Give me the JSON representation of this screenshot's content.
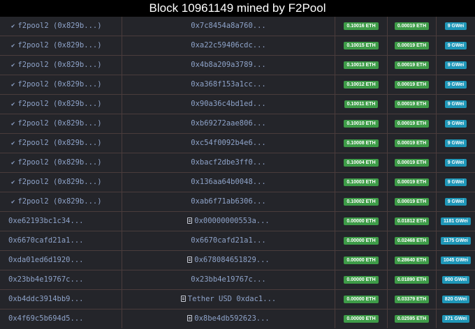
{
  "title": "Block 10961149 mined by F2Pool",
  "colors": {
    "value_badge": "#3e9c48",
    "fee_badge": "#3e9c48",
    "gas_badge": "#1f97b8",
    "address": "#8ea3c9",
    "background": "#24252a"
  },
  "icons": {
    "miner_check": "checkmark-icon",
    "contract": "document-icon"
  },
  "check_glyph": "✔",
  "rows": [
    {
      "miner": true,
      "from": "f2pool2 (0x829b...)",
      "contract": false,
      "to": "0x7c8454a8a760...",
      "value": "0.10016 ETH",
      "fee": "0.00019 ETH",
      "gas": "9 GWei"
    },
    {
      "miner": true,
      "from": "f2pool2 (0x829b...)",
      "contract": false,
      "to": "0xa22c59406cdc...",
      "value": "0.10015 ETH",
      "fee": "0.00019 ETH",
      "gas": "9 GWei"
    },
    {
      "miner": true,
      "from": "f2pool2 (0x829b...)",
      "contract": false,
      "to": "0x4b8a209a3789...",
      "value": "0.10013 ETH",
      "fee": "0.00019 ETH",
      "gas": "9 GWei"
    },
    {
      "miner": true,
      "from": "f2pool2 (0x829b...)",
      "contract": false,
      "to": "0xa368f153a1cc...",
      "value": "0.10012 ETH",
      "fee": "0.00019 ETH",
      "gas": "9 GWei"
    },
    {
      "miner": true,
      "from": "f2pool2 (0x829b...)",
      "contract": false,
      "to": "0x90a36c4bd1ed...",
      "value": "0.10011 ETH",
      "fee": "0.00019 ETH",
      "gas": "9 GWei"
    },
    {
      "miner": true,
      "from": "f2pool2 (0x829b...)",
      "contract": false,
      "to": "0xb69272aae806...",
      "value": "0.10010 ETH",
      "fee": "0.00019 ETH",
      "gas": "9 GWei"
    },
    {
      "miner": true,
      "from": "f2pool2 (0x829b...)",
      "contract": false,
      "to": "0xc54f0092b4e6...",
      "value": "0.10008 ETH",
      "fee": "0.00019 ETH",
      "gas": "9 GWei"
    },
    {
      "miner": true,
      "from": "f2pool2 (0x829b...)",
      "contract": false,
      "to": "0xbacf2dbe3ff0...",
      "value": "0.10004 ETH",
      "fee": "0.00019 ETH",
      "gas": "9 GWei"
    },
    {
      "miner": true,
      "from": "f2pool2 (0x829b...)",
      "contract": false,
      "to": "0x136aa64b0048...",
      "value": "0.10003 ETH",
      "fee": "0.00019 ETH",
      "gas": "9 GWei"
    },
    {
      "miner": true,
      "from": "f2pool2 (0x829b...)",
      "contract": false,
      "to": "0xab6f71ab6306...",
      "value": "0.10002 ETH",
      "fee": "0.00019 ETH",
      "gas": "9 GWei"
    },
    {
      "miner": false,
      "from": "0xe62193bc1c34...",
      "contract": true,
      "to": "0x00000000553a...",
      "value": "0.00000 ETH",
      "fee": "0.01812 ETH",
      "gas": "1181 GWei"
    },
    {
      "miner": false,
      "from": "0x6670cafd21a1...",
      "contract": false,
      "to": "0x6670cafd21a1...",
      "value": "0.00000 ETH",
      "fee": "0.02468 ETH",
      "gas": "1175 GWei"
    },
    {
      "miner": false,
      "from": "0xda01ed6d1920...",
      "contract": true,
      "to": "0x678084651829...",
      "value": "0.00000 ETH",
      "fee": "0.28640 ETH",
      "gas": "1045 GWei"
    },
    {
      "miner": false,
      "from": "0x23bb4e19767c...",
      "contract": false,
      "to": "0x23bb4e19767c...",
      "value": "0.00000 ETH",
      "fee": "0.01890 ETH",
      "gas": "900 GWei"
    },
    {
      "miner": false,
      "from": "0xb4ddc3914bb9...",
      "contract": true,
      "to": "Tether USD 0xdac1...",
      "value": "0.00000 ETH",
      "fee": "0.03379 ETH",
      "gas": "820 GWei"
    },
    {
      "miner": false,
      "from": "0x4f69c5b694d5...",
      "contract": true,
      "to": "0x8be4db592623...",
      "value": "0.00000 ETH",
      "fee": "0.02595 ETH",
      "gas": "371 GWei"
    }
  ]
}
